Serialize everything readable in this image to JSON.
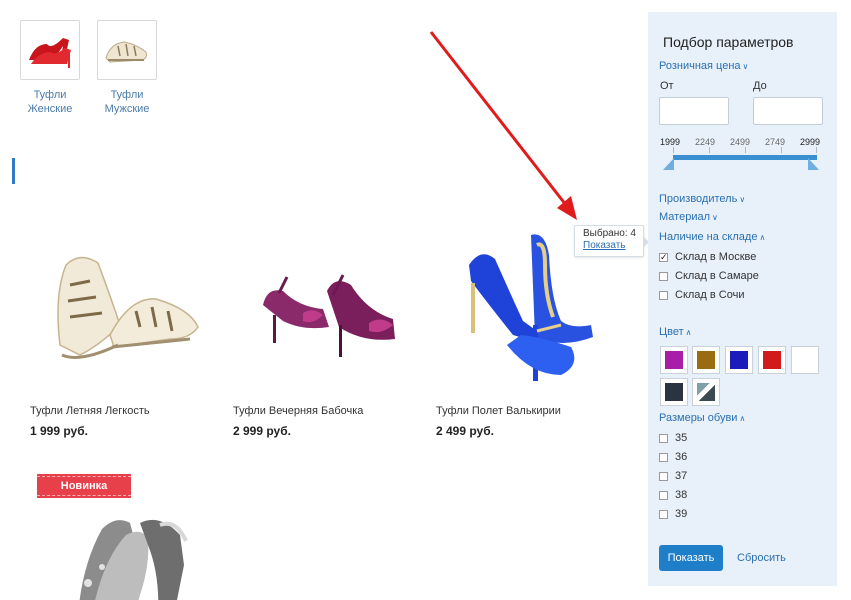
{
  "sections": [
    {
      "name_line1": "Туфли",
      "name_line2": "Женские",
      "icon": "red-heels-icon"
    },
    {
      "name_line1": "Туфли",
      "name_line2": "Мужские",
      "icon": "beige-shoe-icon"
    }
  ],
  "products": [
    {
      "name": "Туфли Летняя Легкость",
      "price": "1 999 руб.",
      "icon": "beige-sandal-image"
    },
    {
      "name": "Туфли Вечерняя Бабочка",
      "price": "2 999 руб.",
      "icon": "purple-bow-heels-image"
    },
    {
      "name": "Туфли Полет Валькирии",
      "price": "2 499 руб.",
      "icon": "blue-strap-heels-image"
    },
    {
      "badge": "Новинка",
      "icon": "silver-heels-image"
    }
  ],
  "popup": {
    "count_text": "Выбрано: 4",
    "show_link": "Показать"
  },
  "filter": {
    "title": "Подбор параметров",
    "price": {
      "label": "Розничная цена",
      "from_label": "От",
      "to_label": "До",
      "scale": [
        "1999",
        "2249",
        "2499",
        "2749",
        "2999"
      ]
    },
    "collapsed_sections": [
      "Производитель",
      "Материал"
    ],
    "stock": {
      "label": "Наличие на складе",
      "options": [
        {
          "label": "Склад в Москве",
          "checked": true
        },
        {
          "label": "Склад в Самаре",
          "checked": false
        },
        {
          "label": "Склад в Сочи",
          "checked": false
        }
      ]
    },
    "color": {
      "label": "Цвет",
      "swatches": [
        "#a81ea8",
        "#9a6b10",
        "#1c1cbc",
        "#d21a1a",
        "#ffffff",
        "#2a3340",
        "pattern"
      ]
    },
    "sizes": {
      "label": "Размеры обуви",
      "options": [
        "35",
        "36",
        "37",
        "38",
        "39"
      ]
    },
    "show_button": "Показать",
    "reset_link": "Сбросить"
  },
  "colors": {
    "accent": "#1e7fc8",
    "link": "#2a6fb0",
    "panel_bg": "#e8f1fa",
    "ribbon": "#e8404a",
    "arrow": "#e01b1b"
  }
}
